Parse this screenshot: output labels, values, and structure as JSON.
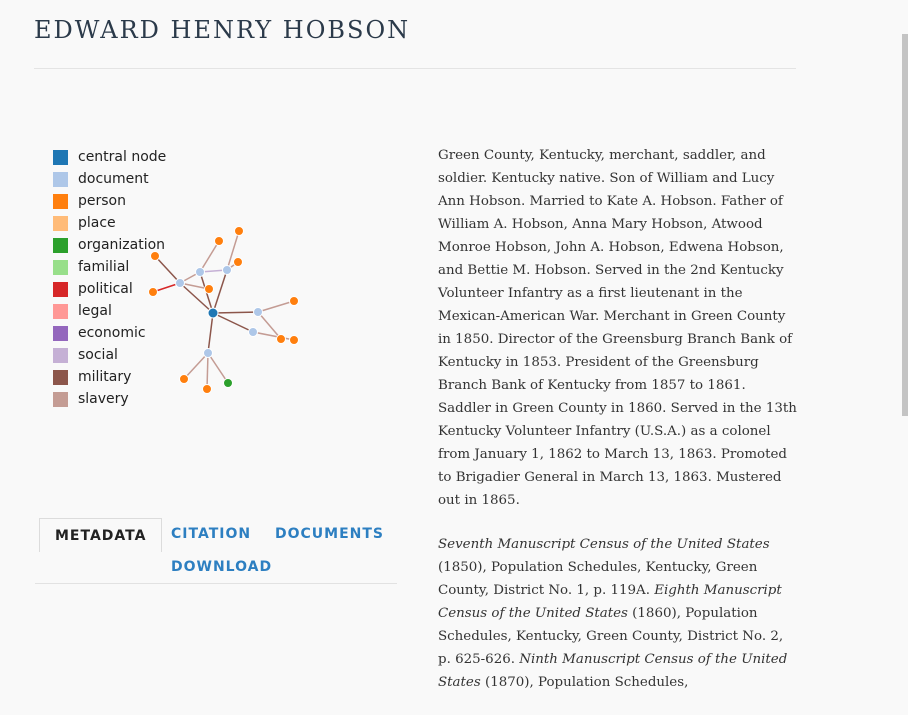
{
  "page": {
    "title": "EDWARD HENRY HOBSON"
  },
  "legend": [
    {
      "label": "central node",
      "color": "#1f77b4"
    },
    {
      "label": "document",
      "color": "#aec7e8"
    },
    {
      "label": "person",
      "color": "#ff7f0e"
    },
    {
      "label": "place",
      "color": "#ffbb78"
    },
    {
      "label": "organization",
      "color": "#2ca02c"
    },
    {
      "label": "familial",
      "color": "#98df8a"
    },
    {
      "label": "political",
      "color": "#d62728"
    },
    {
      "label": "legal",
      "color": "#ff9896"
    },
    {
      "label": "economic",
      "color": "#9467bd"
    },
    {
      "label": "social",
      "color": "#c5b0d5"
    },
    {
      "label": "military",
      "color": "#8c564b"
    },
    {
      "label": "slavery",
      "color": "#c49c94"
    }
  ],
  "bio": {
    "paragraph": "Green County, Kentucky, merchant, saddler, and soldier. Kentucky native. Son of William and Lucy Ann Hobson. Married to Kate A. Hobson. Father of William A. Hobson, Anna Mary Hobson, Atwood Monroe Hobson, John A. Hobson, Edwena Hobson, and Bettie M. Hobson. Served in the 2nd Kentucky Volunteer Infantry as a first lieutenant in the Mexican-American War. Merchant in Green County in 1850. Director of the Greensburg Branch Bank of Kentucky in 1853. President of the Greensburg Branch Bank of Kentucky from 1857 to 1861. Saddler in Green County in 1860. Served in the 13th Kentucky Volunteer Infantry (U.S.A.) as a colonel from January 1, 1862 to March 13, 1863. Promoted to Brigadier General in March 13, 1863. Mustered out in 1865.",
    "citations": {
      "c1_title": "Seventh Manuscript Census of the United States",
      "c1_rest": " (1850), Population Schedules, Kentucky, Green County, District No. 1, p. 119A. ",
      "c2_title": "Eighth Manuscript Census of the United States",
      "c2_rest": " (1860), Population Schedules, Kentucky, Green County, District No. 2, p. 625-626. ",
      "c3_title": "Ninth Manuscript Census of the United States",
      "c3_rest": " (1870), Population Schedules,"
    }
  },
  "tabs": {
    "metadata": "METADATA",
    "citation": "CITATION",
    "documents": "DOCUMENTS",
    "download": "DOWNLOAD"
  }
}
